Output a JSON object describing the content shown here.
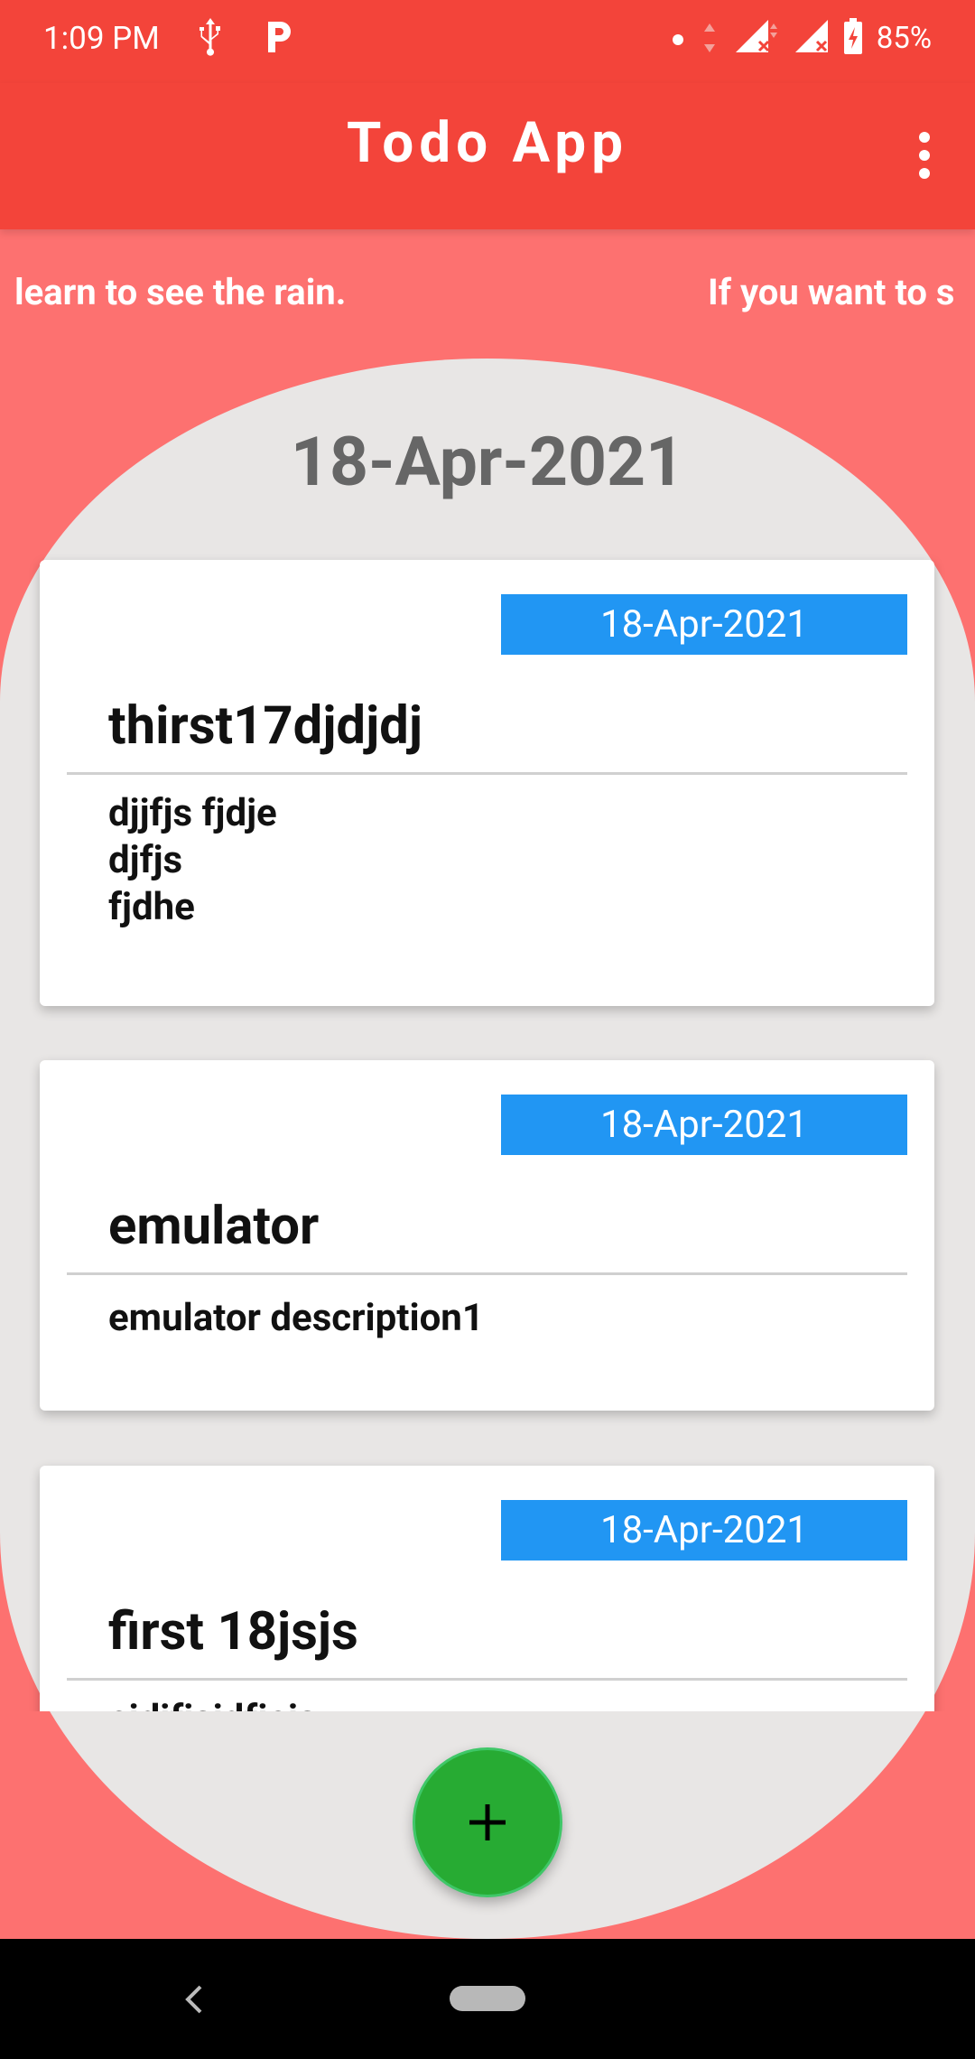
{
  "status_bar": {
    "time": "1:09 PM",
    "battery": "85%",
    "icons": [
      "usb-icon",
      "parking-icon",
      "dot-icon",
      "data-arrows-icon",
      "signal-1-icon",
      "signal-2-icon",
      "battery-charging-icon"
    ]
  },
  "app_bar": {
    "title": "Todo App",
    "menu_icon": "more-vert-icon"
  },
  "marquee": {
    "text_a": "learn to see the rain.",
    "text_b": "If you want to s"
  },
  "date_heading": "18-Apr-2021",
  "todos": [
    {
      "date": "18-Apr-2021",
      "title": "thirst17djdjdj",
      "description": "djjfjs fjdje\ndjfjs\nfjdhe"
    },
    {
      "date": "18-Apr-2021",
      "title": "emulator",
      "description": "emulator description1"
    },
    {
      "date": "18-Apr-2021",
      "title": "first 18jsjs",
      "description": "ejdjfjsjdfjejs"
    }
  ],
  "fab": {
    "icon": "plus-icon"
  },
  "nav": {
    "back_icon": "back-chevron-icon",
    "home_icon": "home-pill-icon"
  },
  "colors": {
    "primary": "#f3443a",
    "background": "#fd7170",
    "panel": "#e8e6e5",
    "date_badge": "#2196f3",
    "fab": "#27ab33"
  }
}
